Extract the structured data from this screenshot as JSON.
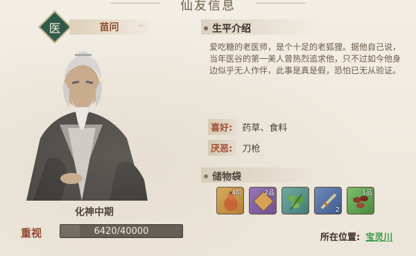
{
  "window": {
    "title": "仙友信息"
  },
  "character": {
    "emblem": "医",
    "name": "苗问",
    "realm": "化神中期"
  },
  "favor": {
    "label": "重视",
    "current": 6420,
    "max": 40000,
    "text": "6420/40000"
  },
  "bio": {
    "header": "生平介绍",
    "text": "爱吃糖的老医师，是个十足的老狐狸。据他自己说，当年医谷的第一美人曾热烈追求他，只不过如今他身边似乎无人作伴，此事是真是假，恐怕已无从验证。"
  },
  "likes": {
    "label": "喜好:",
    "value": "药草、食料"
  },
  "dislikes": {
    "label": "厌恶:",
    "value": "刀枪"
  },
  "bag": {
    "header": "储物袋",
    "items": [
      {
        "icon": "gourd-icon",
        "badge": "4阶",
        "count": ""
      },
      {
        "icon": "scroll-icon",
        "badge": "2品",
        "count": ""
      },
      {
        "icon": "herb-icon",
        "badge": "",
        "count": ""
      },
      {
        "icon": "sword-icon",
        "badge": "",
        "count": "2"
      },
      {
        "icon": "beans-icon",
        "badge": "1品",
        "count": ""
      }
    ]
  },
  "location": {
    "label": "所在位置:",
    "value": "宝灵川"
  },
  "colors": {
    "accent_red": "#8b3b22",
    "location_green": "#3b9a4a",
    "emblem_green": "#2f5a4a"
  }
}
